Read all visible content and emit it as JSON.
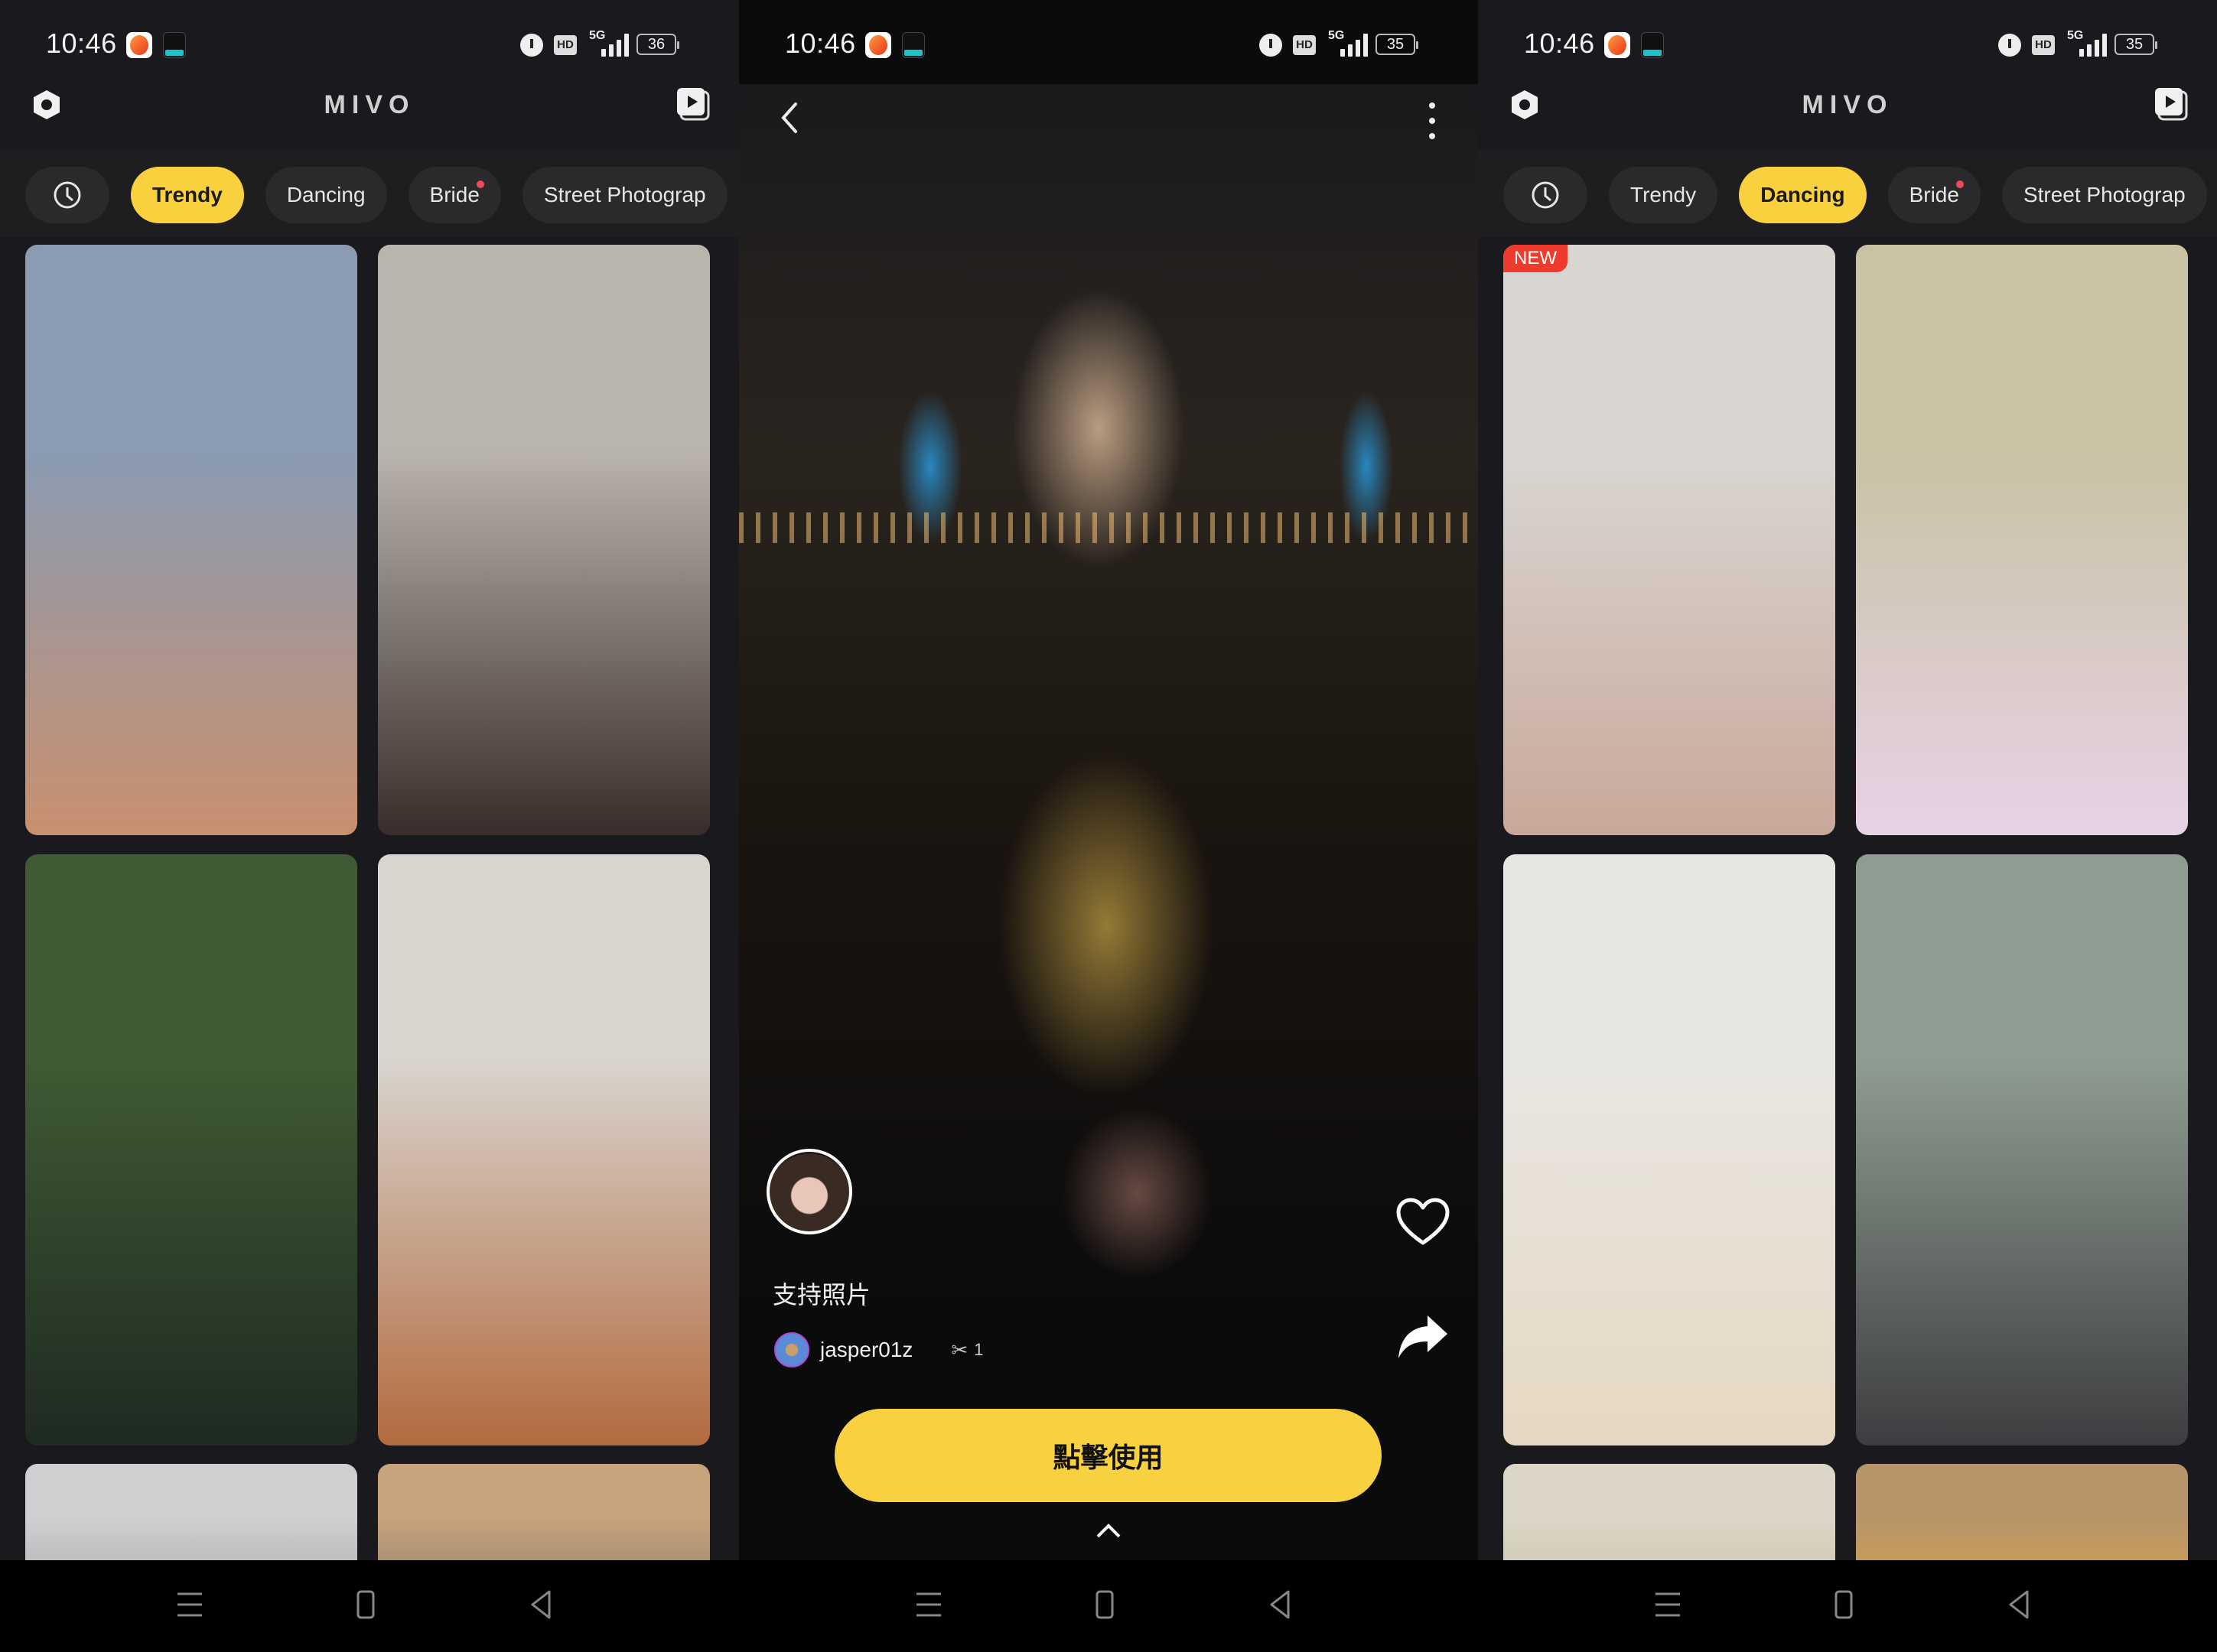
{
  "status_bar": [
    {
      "time": "10:46",
      "battery": "36",
      "network": "5G"
    },
    {
      "time": "10:46",
      "battery": "35",
      "network": "5G"
    },
    {
      "time": "10:46",
      "battery": "35",
      "network": "5G"
    }
  ],
  "app": {
    "title": "MIVO"
  },
  "panels": {
    "browse_trendy": {
      "active_tab": "Trendy",
      "tabs": [
        "Trendy",
        "Dancing",
        "Bride",
        "Street Photograp"
      ],
      "tab_badge": "Bride",
      "tiles": [
        {
          "label": "man-beach",
          "badge": null,
          "colors": [
            "#8a9bb2",
            "#c9906e"
          ]
        },
        {
          "label": "woman-black-top",
          "badge": null,
          "colors": [
            "#b9b4ac",
            "#3a2c2a"
          ]
        },
        {
          "label": "man-tuxedo",
          "badge": null,
          "colors": [
            "#3f5a34",
            "#1e2a22"
          ]
        },
        {
          "label": "woman-orange-dress",
          "badge": null,
          "colors": [
            "#d8d4ce",
            "#b36a3e"
          ]
        },
        {
          "label": "ceiling",
          "badge": null,
          "colors": [
            "#cfcfd1",
            "#a9a9ab"
          ]
        },
        {
          "label": "wood-wall",
          "badge": null,
          "colors": [
            "#c7a47c",
            "#8c7966"
          ]
        }
      ]
    },
    "detail": {
      "caption": "支持照片",
      "username": "jasper01z",
      "use_count": "1",
      "use_button_label": "點擊使用"
    },
    "browse_dancing": {
      "active_tab": "Dancing",
      "tabs": [
        "Trendy",
        "Dancing",
        "Bride",
        "Street Photograp"
      ],
      "tab_badge": "Bride",
      "new_badge": "NEW",
      "tiles": [
        {
          "label": "dancer-striped-top",
          "badge": "NEW",
          "colors": [
            "#d9d6d2",
            "#c9a89a"
          ]
        },
        {
          "label": "dancer-pink-skirt",
          "badge": null,
          "colors": [
            "#c9c2a4",
            "#e7d2e6"
          ]
        },
        {
          "label": "dancer-cream-sweater",
          "badge": null,
          "colors": [
            "#e8e6e2",
            "#e6d8c2"
          ]
        },
        {
          "label": "dancer-leather-outfit",
          "badge": null,
          "colors": [
            "#8f9c91",
            "#3d3d40"
          ]
        },
        {
          "label": "hallway-wall",
          "badge": null,
          "colors": [
            "#dcd6c6",
            "#c8c0ab"
          ]
        },
        {
          "label": "wood-cabinet",
          "badge": null,
          "colors": [
            "#b8946a",
            "#d7a346"
          ]
        }
      ]
    }
  },
  "colors": {
    "accent": "#f9d13e",
    "badge_dot": "#ef4b5a",
    "new_badge": "#ef3b2d",
    "background": "#1a1a1e"
  }
}
